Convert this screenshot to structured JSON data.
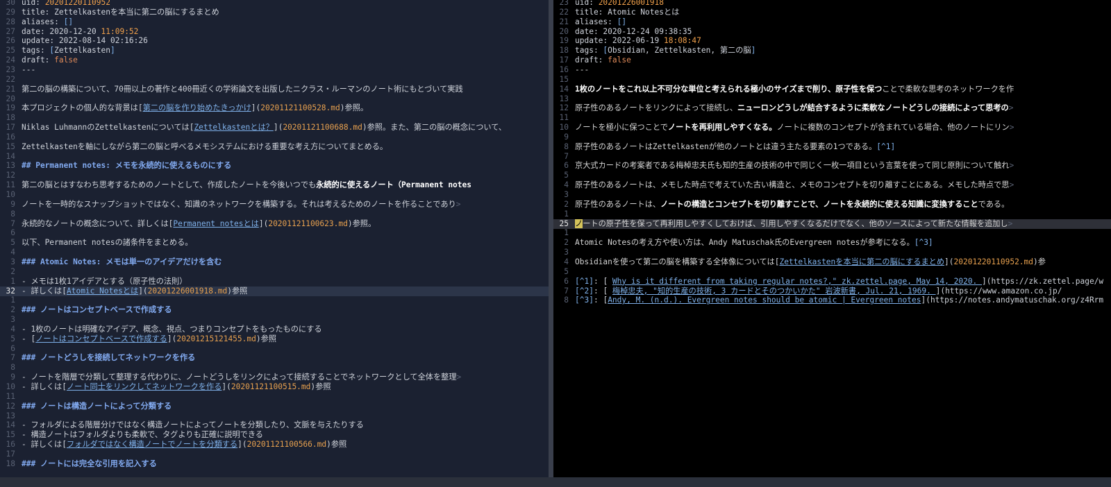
{
  "left": {
    "lines": [
      {
        "n": "30",
        "segs": [
          [
            "key",
            "uid: "
          ],
          [
            "hl",
            "20201220110952"
          ]
        ]
      },
      {
        "n": "29",
        "segs": [
          [
            "key",
            "title: Zettelkastenを本当に第二の脳にするまとめ"
          ]
        ]
      },
      {
        "n": "28",
        "segs": [
          [
            "key",
            "aliases: "
          ],
          [
            "arr",
            "[]"
          ]
        ]
      },
      {
        "n": "27",
        "segs": [
          [
            "key",
            "date: 2020-12-20 "
          ],
          [
            "hl",
            "11:09:52"
          ]
        ]
      },
      {
        "n": "26",
        "segs": [
          [
            "key",
            "update: 2022-08-14 02:16:26"
          ]
        ]
      },
      {
        "n": "25",
        "segs": [
          [
            "key",
            "tags: "
          ],
          [
            "arr",
            "["
          ],
          [
            "key",
            "Zettelkasten"
          ],
          [
            "arr",
            "]"
          ]
        ]
      },
      {
        "n": "24",
        "segs": [
          [
            "key",
            "draft: "
          ],
          [
            "bool",
            "false"
          ]
        ]
      },
      {
        "n": "23",
        "segs": [
          [
            "txt",
            "---"
          ]
        ]
      },
      {
        "n": "22",
        "segs": []
      },
      {
        "n": "21",
        "segs": [
          [
            "txt",
            "第二の脳の構築について、70冊以上の著作と400冊近くの学術論文を出版したニクラス・ルーマンのノート術にもとづいて実践"
          ]
        ]
      },
      {
        "n": "20",
        "segs": []
      },
      {
        "n": "19",
        "segs": [
          [
            "txt",
            "本プロジェクトの個人的な背景は"
          ],
          [
            "brk",
            "["
          ],
          [
            "link",
            "第二の脳を作り始めたきっかけ"
          ],
          [
            "brk",
            "]("
          ],
          [
            "path",
            "20201121100528.md"
          ],
          [
            "brk",
            ")"
          ],
          [
            "txt",
            "参照。"
          ]
        ]
      },
      {
        "n": "18",
        "segs": []
      },
      {
        "n": "17",
        "segs": [
          [
            "txt",
            "Niklas LuhmannのZettelkastenについては"
          ],
          [
            "brk",
            "["
          ],
          [
            "link",
            "Zettelkastenとは？"
          ],
          [
            "brk",
            "]("
          ],
          [
            "path",
            "20201121100688.md"
          ],
          [
            "brk",
            ")"
          ],
          [
            "txt",
            "参照。また、第二の脳の概念について、"
          ]
        ]
      },
      {
        "n": "16",
        "segs": []
      },
      {
        "n": "15",
        "segs": [
          [
            "txt",
            "Zettelkastenを軸にしながら第二の脳と呼べるメモシステムにおける重要な考え方についてまとめる。"
          ]
        ]
      },
      {
        "n": "14",
        "segs": []
      },
      {
        "n": "13",
        "segs": [
          [
            "head",
            "## Permanent notes: メモを永続的に使えるものにする"
          ]
        ]
      },
      {
        "n": "12",
        "segs": []
      },
      {
        "n": "11",
        "segs": [
          [
            "txt",
            "第二の脳とはすなわち思考するためのノートとして、作成したノートを今後いつでも"
          ],
          [
            "bold",
            "永続的に使えるノート（Permanent notes"
          ]
        ]
      },
      {
        "n": "10",
        "segs": []
      },
      {
        "n": "9",
        "segs": [
          [
            "txt",
            "ノートを一時的なスナップショットではなく、知識のネットワークを構築する。それは考えるためのノートを作ることであり"
          ],
          [
            "more",
            ">"
          ]
        ]
      },
      {
        "n": "8",
        "segs": []
      },
      {
        "n": "7",
        "segs": [
          [
            "txt",
            "永続的なノートの概念について、詳しくは"
          ],
          [
            "brk",
            "["
          ],
          [
            "link",
            "Permanent notesとは"
          ],
          [
            "brk",
            "]("
          ],
          [
            "path",
            "20201121100623.md"
          ],
          [
            "brk",
            ")"
          ],
          [
            "txt",
            "参照。"
          ]
        ]
      },
      {
        "n": "6",
        "segs": []
      },
      {
        "n": "5",
        "segs": [
          [
            "txt",
            "以下、Permanent notesの諸条件をまとめる。"
          ]
        ]
      },
      {
        "n": "4",
        "segs": []
      },
      {
        "n": "3",
        "segs": [
          [
            "head",
            "### Atomic Notes: メモは単一のアイデアだけを含む"
          ]
        ]
      },
      {
        "n": "2",
        "segs": []
      },
      {
        "n": "1",
        "segs": [
          [
            "bullet",
            "- メモは1枚1アイデアとする（原子性の法則）"
          ]
        ]
      },
      {
        "n": "32",
        "cur": true,
        "segs": [
          [
            "bullet",
            "- 詳しくは"
          ],
          [
            "brk",
            "["
          ],
          [
            "link",
            "Atomic Notesとは"
          ],
          [
            "brk",
            "]("
          ],
          [
            "path",
            "20201226001918.md"
          ],
          [
            "brk",
            ")"
          ],
          [
            "txt",
            "参照"
          ]
        ]
      },
      {
        "n": "1",
        "segs": []
      },
      {
        "n": "2",
        "segs": [
          [
            "head",
            "### ノートはコンセプトベースで作成する"
          ]
        ]
      },
      {
        "n": "3",
        "segs": []
      },
      {
        "n": "4",
        "segs": [
          [
            "bullet",
            "- 1枚のノートは明確なアイデア、概念、視点、つまりコンセプトをもったものにする"
          ]
        ]
      },
      {
        "n": "5",
        "segs": [
          [
            "bullet",
            "- "
          ],
          [
            "brk",
            "["
          ],
          [
            "link",
            "ノートはコンセプトベースで作成する"
          ],
          [
            "brk",
            "]("
          ],
          [
            "path",
            "20201215121455.md"
          ],
          [
            "brk",
            ")"
          ],
          [
            "txt",
            "参照"
          ]
        ]
      },
      {
        "n": "6",
        "segs": []
      },
      {
        "n": "7",
        "segs": [
          [
            "head",
            "### ノートどうしを接続してネットワークを作る"
          ]
        ]
      },
      {
        "n": "8",
        "segs": []
      },
      {
        "n": "9",
        "segs": [
          [
            "bullet",
            "- ノートを階層で分類して整理する代わりに、ノートどうしをリンクによって接続することでネットワークとして全体を整理"
          ],
          [
            "more",
            ">"
          ]
        ]
      },
      {
        "n": "10",
        "segs": [
          [
            "bullet",
            "- 詳しくは"
          ],
          [
            "brk",
            "["
          ],
          [
            "link",
            "ノート同士をリンクしてネットワークを作る"
          ],
          [
            "brk",
            "]("
          ],
          [
            "path",
            "20201121100515.md"
          ],
          [
            "brk",
            ")"
          ],
          [
            "txt",
            "参照"
          ]
        ]
      },
      {
        "n": "11",
        "segs": []
      },
      {
        "n": "12",
        "segs": [
          [
            "head",
            "### ノートは構造ノートによって分類する"
          ]
        ]
      },
      {
        "n": "13",
        "segs": []
      },
      {
        "n": "14",
        "segs": [
          [
            "bullet",
            "- フォルダによる階層分けではなく構造ノートによってノートを分類したり、文脈を与えたりする"
          ]
        ]
      },
      {
        "n": "15",
        "segs": [
          [
            "bullet",
            "- 構造ノートはフォルダよりも柔軟で、タグよりも正確に説明できる"
          ]
        ]
      },
      {
        "n": "16",
        "segs": [
          [
            "bullet",
            "- 詳しくは"
          ],
          [
            "brk",
            "["
          ],
          [
            "link",
            "フォルダではなく構造ノートでノートを分類する"
          ],
          [
            "brk",
            "]("
          ],
          [
            "path",
            "20201121100566.md"
          ],
          [
            "brk",
            ")"
          ],
          [
            "txt",
            "参照"
          ]
        ]
      },
      {
        "n": "17",
        "segs": []
      },
      {
        "n": "18",
        "segs": [
          [
            "head",
            "### ノートには完全な引用を記入する"
          ]
        ]
      }
    ]
  },
  "right": {
    "lines": [
      {
        "n": "23",
        "segs": [
          [
            "key",
            "uid: "
          ],
          [
            "hl",
            "20201226001918"
          ]
        ]
      },
      {
        "n": "22",
        "segs": [
          [
            "key",
            "title: Atomic Notesとは"
          ]
        ]
      },
      {
        "n": "21",
        "segs": [
          [
            "key",
            "aliases: "
          ],
          [
            "arr",
            "[]"
          ]
        ]
      },
      {
        "n": "20",
        "segs": [
          [
            "key",
            "date: 2020-12-24 09:38:35"
          ]
        ]
      },
      {
        "n": "19",
        "segs": [
          [
            "key",
            "update: 2022-06-19 "
          ],
          [
            "hl",
            "18:08:47"
          ]
        ]
      },
      {
        "n": "18",
        "segs": [
          [
            "key",
            "tags: "
          ],
          [
            "arr",
            "["
          ],
          [
            "key",
            "Obsidian, Zettelkasten, 第二の脳"
          ],
          [
            "arr",
            "]"
          ]
        ]
      },
      {
        "n": "17",
        "segs": [
          [
            "key",
            "draft: "
          ],
          [
            "bool",
            "false"
          ]
        ]
      },
      {
        "n": "16",
        "segs": [
          [
            "txt",
            "---"
          ]
        ]
      },
      {
        "n": "15",
        "segs": []
      },
      {
        "n": "14",
        "segs": [
          [
            "bold",
            "1枚のノートをこれ以上不可分な単位と考えられる極小のサイズまで削り、原子性を保つ"
          ],
          [
            "txt",
            "ことで柔軟な思考のネットワークを作"
          ]
        ]
      },
      {
        "n": "13",
        "segs": []
      },
      {
        "n": "12",
        "segs": [
          [
            "txt",
            "原子性のあるノートをリンクによって接続し、"
          ],
          [
            "bold",
            "ニューロンどうしが結合するように柔軟なノートどうしの接続によって思考の"
          ],
          [
            "more",
            ">"
          ]
        ]
      },
      {
        "n": "11",
        "segs": []
      },
      {
        "n": "10",
        "segs": [
          [
            "txt",
            "ノートを極小に保つことで"
          ],
          [
            "bold",
            "ノートを再利用しやすくなる。"
          ],
          [
            "txt",
            "ノートに複数のコンセプトが含まれている場合、他のノートにリン"
          ],
          [
            "more",
            ">"
          ]
        ]
      },
      {
        "n": "9",
        "segs": []
      },
      {
        "n": "8",
        "segs": [
          [
            "txt",
            "原子性のあるノートはZettelkastenが他のノートとは違う主たる要素の1つである。"
          ],
          [
            "fn",
            "[^1]"
          ]
        ]
      },
      {
        "n": "7",
        "segs": []
      },
      {
        "n": "6",
        "segs": [
          [
            "txt",
            "京大式カードの考案者である梅棹忠夫氏も知的生産の技術の中で同じく一枚一項目という言葉を使って同じ原則について触れ"
          ],
          [
            "more",
            ">"
          ]
        ]
      },
      {
        "n": "5",
        "segs": []
      },
      {
        "n": "4",
        "segs": [
          [
            "txt",
            "原子性のあるノートは、メモした時点で考えていた古い構造と、メモのコンセプトを切り離すことにある。メモした時点で思"
          ],
          [
            "more",
            ">"
          ]
        ]
      },
      {
        "n": "3",
        "segs": []
      },
      {
        "n": "2",
        "segs": [
          [
            "txt",
            "原子性のあるノートは、"
          ],
          [
            "bold",
            "ノートの構造とコンセプトを切り離すことで、ノートを永続的に使える知識に変換すること"
          ],
          [
            "txt",
            "である。"
          ]
        ]
      },
      {
        "n": "1",
        "segs": []
      },
      {
        "n": "25",
        "cur": true,
        "segs": [
          [
            "cursor",
            "ノ"
          ],
          [
            "txt",
            "ートの原子性を保って再利用しやすくしておけば、引用しやすくなるだけでなく、他のソースによって新たな情報を追加し"
          ],
          [
            "more",
            ">"
          ]
        ]
      },
      {
        "n": "1",
        "segs": []
      },
      {
        "n": "2",
        "segs": [
          [
            "txt",
            "Atomic Notesの考え方や使い方は、Andy Matuschak氏のEvergreen notesが参考になる。"
          ],
          [
            "fn",
            "[^3]"
          ]
        ]
      },
      {
        "n": "3",
        "segs": []
      },
      {
        "n": "4",
        "segs": [
          [
            "txt",
            "Obsidianを使って第二の脳を構築する全体像については"
          ],
          [
            "brk",
            "["
          ],
          [
            "link",
            "Zettelkastenを本当に第二の脳にするまとめ"
          ],
          [
            "brk",
            "]("
          ],
          [
            "path",
            "20201220110952.md"
          ],
          [
            "brk",
            ")"
          ],
          [
            "txt",
            "参"
          ]
        ]
      },
      {
        "n": "5",
        "segs": []
      },
      {
        "n": "6",
        "segs": [
          [
            "fn",
            "[^1]"
          ],
          [
            "txt",
            ": "
          ],
          [
            "brk",
            "[ "
          ],
          [
            "link",
            "Why is it different from taking regular notes?,\" zk.zettel.page, May 14, 2020. "
          ],
          [
            "brk",
            "](https://zk.zettel.page/w"
          ]
        ]
      },
      {
        "n": "7",
        "segs": [
          [
            "fn",
            "[^2]"
          ],
          [
            "txt",
            ": "
          ],
          [
            "brk",
            "[ "
          ],
          [
            "link",
            "梅棹忠夫, \"知的生産の技術, 3 カードとそのつかいかた\" 岩波新書, Jul. 21, 1969. "
          ],
          [
            "brk",
            "](https://www.amazon.co.jp/"
          ]
        ]
      },
      {
        "n": "8",
        "segs": [
          [
            "fn",
            "[^3]"
          ],
          [
            "txt",
            ": "
          ],
          [
            "brk",
            "["
          ],
          [
            "link",
            "Andy, M. (n.d.). Evergreen notes should be atomic | Evergreen notes"
          ],
          [
            "brk",
            "](https://notes.andymatuschak.org/z4Rrm"
          ]
        ]
      }
    ]
  }
}
